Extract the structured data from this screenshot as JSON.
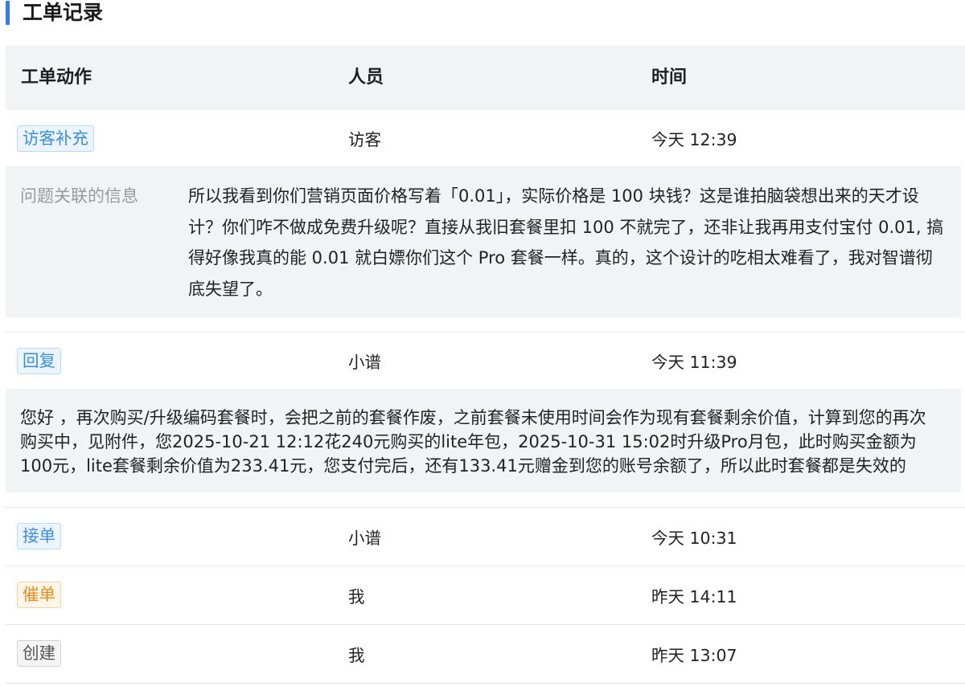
{
  "title": "工单记录",
  "accent_color": "#2f7cf6",
  "table": {
    "columns": {
      "action": "工单动作",
      "person": "人员",
      "time": "时间"
    },
    "records": [
      {
        "action": "访客补充",
        "tag_colors": {
          "text": "#3a8ee0",
          "bg": "#ecf5ff",
          "border": "#b8d9f8"
        },
        "person": "访客",
        "time": "今天 12:39",
        "detail": {
          "label": "问题关联的信息",
          "text": "所以我看到你们营销页面价格写着「0.01」，实际价格是 100 块钱？这是谁拍脑袋想出来的天才设计？你们咋不做成免费升级呢？直接从我旧套餐里扣 100 不就完了，还非让我再用支付宝付 0.01, 搞得好像我真的能 0.01 就白嫖你们这个 Pro 套餐一样。真的，这个设计的吃相太难看了，我对智谱彻底失望了。"
        }
      },
      {
        "action": "回复",
        "tag_colors": {
          "text": "#3a8ee0",
          "bg": "#ecf5ff",
          "border": "#b8d9f8"
        },
        "person": "小谱",
        "time": "今天 11:39",
        "detail": {
          "text": "您好 ，再次购买/升级编码套餐时，会把之前的套餐作废，之前套餐未使用时间会作为现有套餐剩余价值，计算到您的再次购买中，见附件，您2025-10-21 12:12花240元购买的lite年包，2025-10-31 15:02时升级Pro月包，此时购买金额为100元，lite套餐剩余价值为233.41元，您支付完后，还有133.41元赠金到您的账号余额了，所以此时套餐都是失效的"
        }
      },
      {
        "action": "接单",
        "tag_colors": {
          "text": "#3a8ee0",
          "bg": "#ecf5ff",
          "border": "#b8d9f8"
        },
        "person": "小谱",
        "time": "今天 10:31"
      },
      {
        "action": "催单",
        "tag_colors": {
          "text": "#ec8a17",
          "bg": "#fff5e8",
          "border": "#f6d4a6"
        },
        "person": "我",
        "time": "昨天 14:11"
      },
      {
        "action": "创建",
        "tag_colors": {
          "text": "#555555",
          "bg": "#f4f4f5",
          "border": "#cfd0d3"
        },
        "person": "我",
        "time": "昨天 13:07"
      }
    ]
  }
}
